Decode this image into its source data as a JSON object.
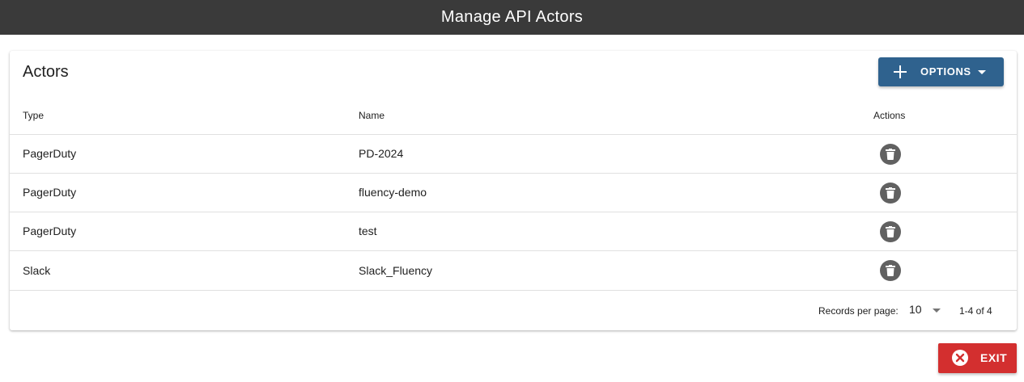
{
  "header": {
    "title": "Manage API Actors"
  },
  "card": {
    "title": "Actors",
    "options_label": "OPTIONS"
  },
  "table": {
    "columns": [
      "Type",
      "Name",
      "Actions"
    ],
    "rows": [
      {
        "type": "PagerDuty",
        "name": "PD-2024",
        "action_icon": "trash-icon"
      },
      {
        "type": "PagerDuty",
        "name": "fluency-demo",
        "action_icon": "trash-icon"
      },
      {
        "type": "PagerDuty",
        "name": "test",
        "action_icon": "trash-icon"
      },
      {
        "type": "Slack",
        "name": "Slack_Fluency",
        "action_icon": "trash-icon"
      }
    ]
  },
  "pagination": {
    "records_per_page_label": "Records per page:",
    "records_per_page_value": "10",
    "range_text": "1-4 of 4"
  },
  "footer": {
    "exit_label": "EXIT"
  },
  "colors": {
    "topbar": "#3a3a3a",
    "primary_button": "#2f628e",
    "exit_button": "#d32f2f",
    "delete_icon_bg": "#616161"
  }
}
